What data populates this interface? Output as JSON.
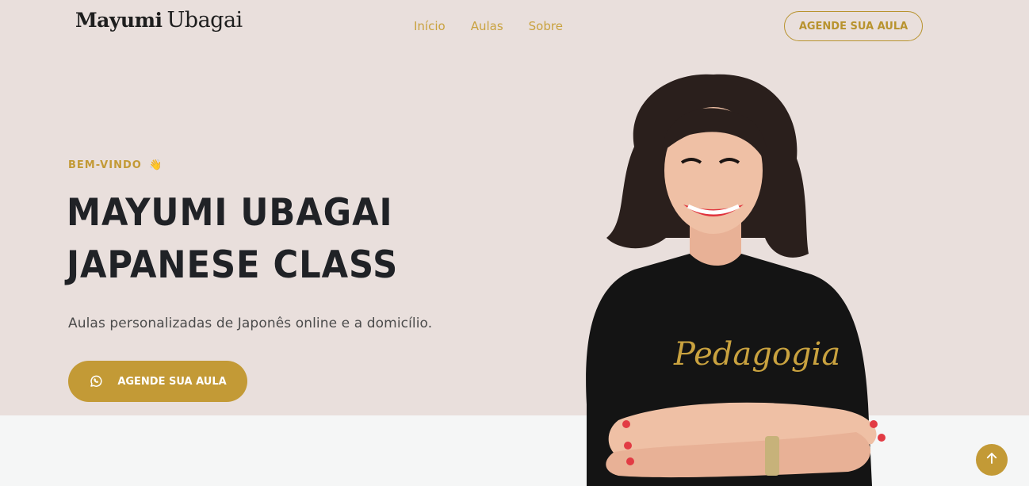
{
  "header": {
    "logo_first": "Mayumi",
    "logo_last": "Ubagai",
    "nav": [
      {
        "label": "Início"
      },
      {
        "label": "Aulas"
      },
      {
        "label": "Sobre"
      }
    ],
    "cta_label": "AGENDE SUA AULA"
  },
  "hero": {
    "eyebrow": "BEM-VINDO",
    "eyebrow_emoji": "👋",
    "title_line1": "MAYUMI UBAGAI",
    "title_line2": "JAPANESE CLASS",
    "subtitle": "Aulas personalizadas de Japonês online e a domicílio.",
    "cta_label": "AGENDE SUA AULA",
    "cta_icon": "whatsapp-icon",
    "photo_shirt_text": "Pedagogia"
  },
  "colors": {
    "accent": "#c39a36",
    "hero_background": "#e9dfdc",
    "heading": "#202226"
  },
  "scroll_top_icon": "arrow-up-icon"
}
